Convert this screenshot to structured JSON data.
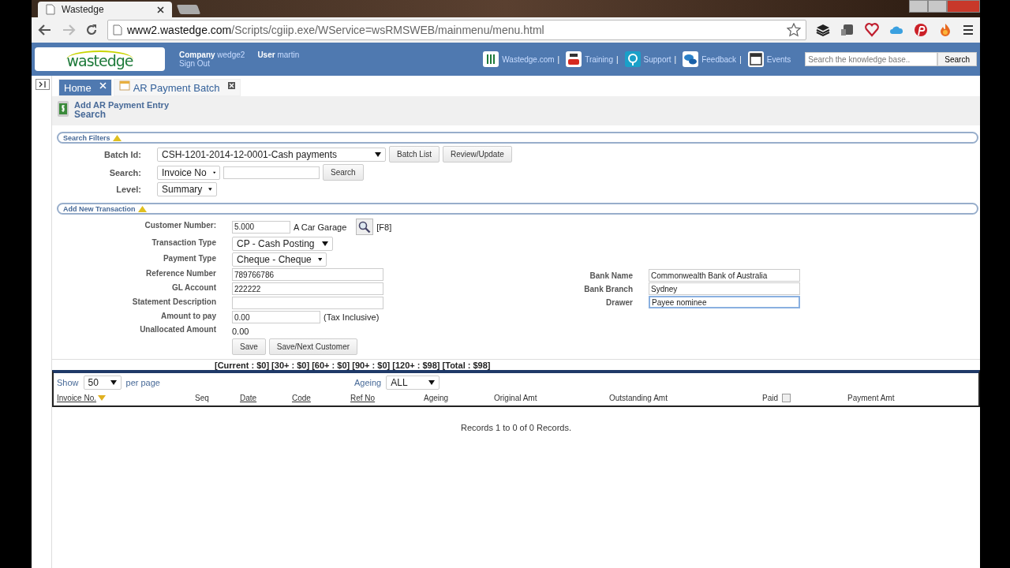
{
  "browser": {
    "tab_title": "Wastedge",
    "url_host": "www2.wastedge.com",
    "url_path": "/Scripts/cgiip.exe/WService=wsRMSWEB/mainmenu/menu.html"
  },
  "header": {
    "logo_text": "wastedge",
    "company_label": "Company",
    "company": "wedge2",
    "user_label": "User",
    "user": "martin",
    "sign_out": "Sign Out",
    "links": [
      {
        "label": "Wastedge.com",
        "separator": "|"
      },
      {
        "label": "Training",
        "separator": "|"
      },
      {
        "label": "Support",
        "separator": "|"
      },
      {
        "label": "Feedback",
        "separator": "|"
      },
      {
        "label": "Events"
      }
    ],
    "search_placeholder": "Search the knowledge base..",
    "search_button": "Search"
  },
  "page_tabs": [
    {
      "label": "Home",
      "selected": true
    },
    {
      "label": "AR Payment Batch",
      "selected": false
    }
  ],
  "actions": [
    "Add AR Payment Entry",
    "Search"
  ],
  "search_filters": {
    "title": "Search Filters",
    "rows": [
      {
        "label": "Batch Id:",
        "controls": [
          {
            "kind": "select",
            "value": "CSH-1201-2014-12-0001-Cash payments"
          },
          {
            "kind": "button",
            "value": "Batch List"
          },
          {
            "kind": "button",
            "value": "Review/Update"
          }
        ]
      },
      {
        "label": "Search:",
        "controls": [
          {
            "kind": "select",
            "value": "Invoice No"
          },
          {
            "kind": "input"
          },
          {
            "kind": "button",
            "value": "Search"
          }
        ]
      },
      {
        "label": "Level:",
        "controls": [
          {
            "kind": "select",
            "value": "Summary"
          }
        ]
      }
    ]
  },
  "transaction": {
    "title": "Add New Transaction",
    "left": [
      {
        "label": "Customer Number:",
        "controls": [
          {
            "kind": "input",
            "value": "5.000"
          },
          {
            "kind": "text",
            "value": "A Car Garage"
          },
          {
            "kind": "lookup"
          },
          {
            "kind": "text",
            "value": "[F8]"
          }
        ]
      },
      {
        "label": "Transaction Type",
        "controls": [
          {
            "kind": "select",
            "value": "CP - Cash Posting"
          }
        ]
      },
      {
        "label": "Payment Type",
        "controls": [
          {
            "kind": "select",
            "value": "Cheque - Cheque"
          }
        ]
      },
      {
        "label": "Reference Number",
        "controls": [
          {
            "kind": "input",
            "value": "789766786"
          }
        ]
      },
      {
        "label": "GL Account",
        "controls": [
          {
            "kind": "input",
            "value": "222222"
          }
        ]
      },
      {
        "label": "Statement Description",
        "controls": [
          {
            "kind": "input"
          }
        ]
      },
      {
        "label": "Amount to pay",
        "controls": [
          {
            "kind": "input",
            "value": "0.00"
          },
          {
            "kind": "text",
            "value": "(Tax Inclusive)"
          }
        ]
      },
      {
        "label": "Unallocated Amount",
        "controls": [
          {
            "kind": "text",
            "value": "0.00"
          }
        ]
      },
      {
        "controls": [
          {
            "kind": "button",
            "value": "Save"
          },
          {
            "kind": "button",
            "value": "Save/Next Customer"
          }
        ]
      }
    ],
    "right": [
      {
        "label": "Bank Name",
        "controls": [
          {
            "kind": "input",
            "value": "Commonwealth Bank of Australia"
          }
        ]
      },
      {
        "label": "Bank Branch",
        "controls": [
          {
            "kind": "input",
            "value": "Sydney"
          }
        ]
      },
      {
        "label": "Drawer",
        "controls": [
          {
            "kind": "input",
            "value": "Payee nominee",
            "focused": true
          }
        ]
      }
    ]
  },
  "ageing_summary": "[Current : $0] [30+ : $0] [60+ : $0] [90+ : $0] [120+ : $98] [Total : $98]",
  "grid": {
    "show_label": "Show",
    "page_size": "50",
    "per_page": "per page",
    "ageing_label": "Ageing",
    "ageing": "ALL",
    "columns": [
      {
        "label": "Invoice No.",
        "sortable": true,
        "sorted": true
      },
      {
        "label": "Seq",
        "sortable": false
      },
      {
        "label": "Date",
        "sortable": true
      },
      {
        "label": "Code",
        "sortable": true
      },
      {
        "label": "Ref No",
        "sortable": true
      },
      {
        "label": "Ageing",
        "sortable": false
      },
      {
        "label": "Original Amt",
        "sortable": false
      },
      {
        "label": "Outstanding Amt",
        "sortable": false
      },
      {
        "label": "Paid",
        "sortable": false,
        "checkbox": true,
        "checked": false
      },
      {
        "label": "Payment Amt",
        "sortable": false
      }
    ],
    "records": "Records 1 to 0 of 0 Records."
  }
}
